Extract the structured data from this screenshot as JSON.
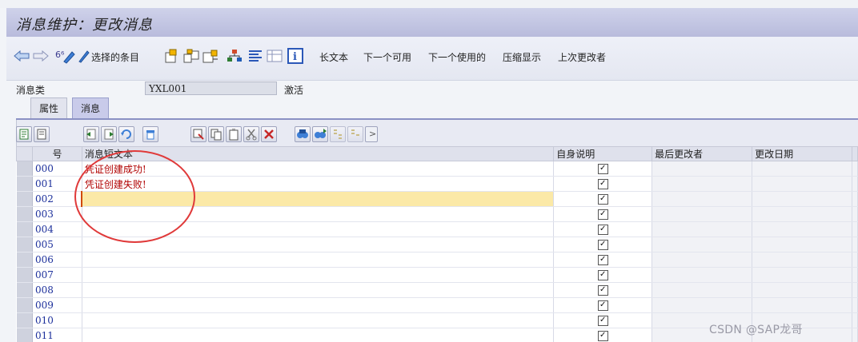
{
  "window": {
    "title": "消息维护：更改消息"
  },
  "toolbar": {
    "selected_items": "选择的条目",
    "long_text": "长文本",
    "next_available": "下一个可用",
    "next_used": "下一个使用的",
    "compress": "压缩显示",
    "last_changer": "上次更改者",
    "glasses_label": "6⁶"
  },
  "header": {
    "message_class_label": "消息类",
    "message_class_value": "YXL001",
    "status": "激活"
  },
  "tabs": {
    "attributes": "属性",
    "messages": "消息"
  },
  "grid_toolbar": {
    "more": ">"
  },
  "table": {
    "columns": {
      "number": "号",
      "short_text": "消息短文本",
      "self_explanatory": "自身说明",
      "last_changed_by": "最后更改者",
      "changed_on": "更改日期"
    },
    "rows": [
      {
        "no": "000",
        "text": "凭证创建成功!",
        "self_explanatory": true
      },
      {
        "no": "001",
        "text": "凭证创建失败!",
        "self_explanatory": true
      },
      {
        "no": "002",
        "text": "",
        "self_explanatory": true
      },
      {
        "no": "003",
        "text": "",
        "self_explanatory": true
      },
      {
        "no": "004",
        "text": "",
        "self_explanatory": true
      },
      {
        "no": "005",
        "text": "",
        "self_explanatory": true
      },
      {
        "no": "006",
        "text": "",
        "self_explanatory": true
      },
      {
        "no": "007",
        "text": "",
        "self_explanatory": true
      },
      {
        "no": "008",
        "text": "",
        "self_explanatory": true
      },
      {
        "no": "009",
        "text": "",
        "self_explanatory": true
      },
      {
        "no": "010",
        "text": "",
        "self_explanatory": true
      },
      {
        "no": "011",
        "text": "",
        "self_explanatory": true
      }
    ],
    "active_row_index": 2
  },
  "watermark": "CSDN @SAP龙哥",
  "colors": {
    "title_bar": "#c3c6e3",
    "annotation_circle": "#e03a3a",
    "row_number": "#1c2f9b",
    "message_text": "#b00000",
    "active_row": "#fbe9a7"
  }
}
